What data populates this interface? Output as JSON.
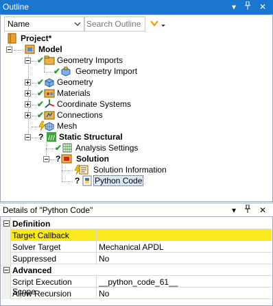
{
  "outline": {
    "title": "Outline",
    "name_select_value": "Name",
    "search_placeholder": "Search Outline",
    "tree": {
      "project": "Project*",
      "model": "Model",
      "geometry_imports": "Geometry Imports",
      "geometry_import": "Geometry Import",
      "geometry": "Geometry",
      "materials": "Materials",
      "coordinate_systems": "Coordinate Systems",
      "connections": "Connections",
      "mesh": "Mesh",
      "static_structural": "Static Structural",
      "analysis_settings": "Analysis Settings",
      "solution": "Solution",
      "solution_information": "Solution Information",
      "python_code": "Python Code",
      "unknown_status": "?"
    }
  },
  "details": {
    "title": "Details of \"Python Code\"",
    "categories": {
      "definition": "Definition",
      "advanced": "Advanced"
    },
    "rows": {
      "target_callback": {
        "key": "Target Callback",
        "value": ""
      },
      "solver_target": {
        "key": "Solver Target",
        "value": "Mechanical APDL"
      },
      "suppressed": {
        "key": "Suppressed",
        "value": "No"
      },
      "script_scope": {
        "key": "Script Execution Scope",
        "value": "__python_code_61__"
      },
      "allow_recursion": {
        "key": "Allow Recursion",
        "value": "No"
      }
    }
  },
  "window_buttons": {
    "dropdown": "▾",
    "pin": "📌",
    "close": "✕"
  },
  "colors": {
    "title_bar": "#1b76d2",
    "highlight_yellow": "#fbe91f",
    "check_green": "#1e9e2c"
  }
}
